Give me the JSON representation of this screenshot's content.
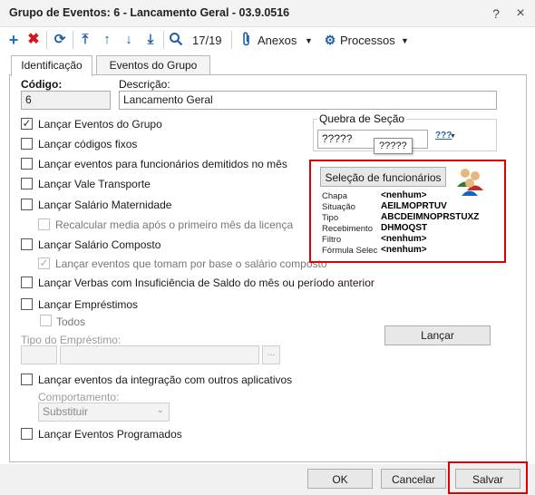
{
  "window": {
    "title": "Grupo de Eventos: 6 - Lancamento Geral - 03.9.0516",
    "help": "?",
    "close": "×"
  },
  "toolbar": {
    "record_position": "17/19",
    "anexos": "Anexos",
    "processos": "Processos",
    "dropdown_arrow": "▼"
  },
  "tabs": [
    "Identificação",
    "Eventos do Grupo"
  ],
  "form": {
    "codigo_label": "Código:",
    "codigo_value": "6",
    "descricao_label": "Descrição:",
    "descricao_value": "Lancamento Geral",
    "quebra_label": "Quebra de Seção",
    "quebra_value": "?????",
    "quebra_tooltip": "?????",
    "quebra_icon_label": "???",
    "checks": {
      "eventos_grupo": {
        "label": "Lançar Eventos do Grupo",
        "checked": true
      },
      "codigos_fixos": {
        "label": "Lançar códigos fixos",
        "checked": false
      },
      "demitidos": {
        "label": "Lançar eventos para funcionários demitidos no mês",
        "checked": false
      },
      "vale_transporte": {
        "label": "Lançar Vale Transporte",
        "checked": false
      },
      "salario_maternidade": {
        "label": "Lançar Salário Maternidade",
        "checked": false
      },
      "recalcular_media": {
        "label": "Recalcular media após o primeiro mês da licença",
        "checked": false
      },
      "salario_composto": {
        "label": "Lançar Salário Composto",
        "checked": false
      },
      "eventos_base_salario": {
        "label": "Lançar eventos que tomam por base o salário composto",
        "checked": true
      },
      "verbas_insuficiencia": {
        "label": "Lançar Verbas com Insuficiência de Saldo do mês ou período anterior",
        "checked": false
      },
      "emprestimos": {
        "label": "Lançar Empréstimos",
        "checked": false
      },
      "todos": {
        "label": "Todos",
        "checked": false
      },
      "integracao": {
        "label": "Lançar eventos da integração com outros aplicativos",
        "checked": false
      },
      "programados": {
        "label": "Lançar Eventos Programados",
        "checked": false
      }
    },
    "tipo_emprestimo_label": "Tipo do Empréstimo:",
    "ellipsis": "...",
    "lancar_button": "Lançar",
    "comportamento_label": "Comportamento:",
    "comportamento_value": "Substituir"
  },
  "selecao": {
    "button": "Seleção de funcionários",
    "rows": [
      {
        "key": "Chapa",
        "value": "<nenhum>"
      },
      {
        "key": "Situação",
        "value": "AEILMOPRTUV"
      },
      {
        "key": "Tipo",
        "value": "ABCDEIMNOPRSTUXZ"
      },
      {
        "key": "Recebimento",
        "value": "DHMOQST"
      },
      {
        "key": "Filtro",
        "value": "<nenhum>"
      },
      {
        "key": "Fórmula Selec",
        "value": "<nenhum>"
      }
    ]
  },
  "footer": {
    "ok": "OK",
    "cancelar": "Cancelar",
    "salvar": "Salvar"
  },
  "colors": {
    "highlight": "#e00000",
    "add_icon": "#1a73c8",
    "delete_icon": "#d21a1a",
    "nav_icon": "#1f5fa8"
  }
}
